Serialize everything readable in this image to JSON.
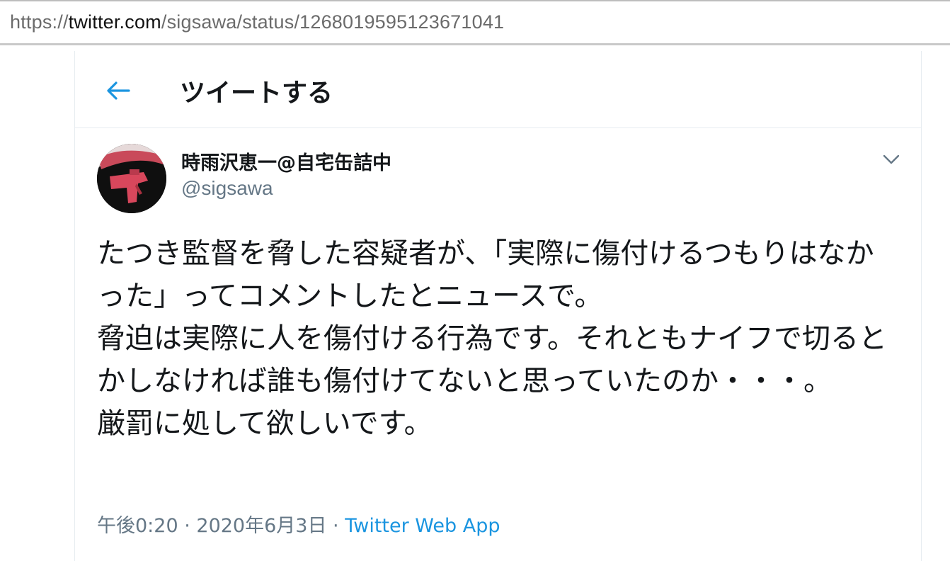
{
  "browser": {
    "url_scheme": "https://",
    "url_host": "twitter.com",
    "url_path": "/sigsawa/status/1268019595123671041"
  },
  "header": {
    "title": "ツイートする",
    "back_icon": "arrow-left-icon"
  },
  "tweet": {
    "display_name": "時雨沢恵一@自宅缶詰中",
    "handle": "@sigsawa",
    "more_icon": "chevron-down-icon",
    "text": "たつき監督を脅した容疑者が、「実際に傷付けるつもりはなかった」ってコメントしたとニュースで。\n脅迫は実際に人を傷付ける行為です。それともナイフで切るとかしなければ誰も傷付けてないと思っていたのか・・・。\n厳罰に処して欲しいです。",
    "time": "午後0:20",
    "sep1": " · ",
    "date": "2020年6月3日",
    "sep2": " · ",
    "source": "Twitter Web App"
  },
  "colors": {
    "accent": "#1b95e0",
    "text_primary": "#14171a",
    "text_secondary": "#657786",
    "border": "#e6ecf0"
  }
}
